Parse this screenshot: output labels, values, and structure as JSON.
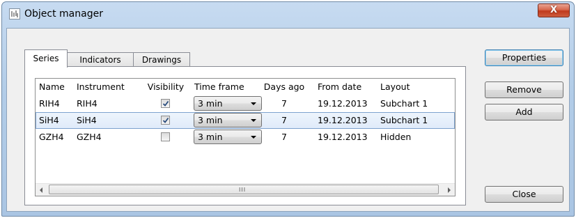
{
  "window": {
    "title": "Object manager",
    "close_glyph": "X",
    "app_icon": "chart-icon",
    "accent_color": "#c7dbf1",
    "close_color": "#c0391c"
  },
  "tabs": [
    {
      "label": "Series",
      "active": true
    },
    {
      "label": "Indicators",
      "active": false
    },
    {
      "label": "Drawings",
      "active": false
    }
  ],
  "table": {
    "columns": [
      "Name",
      "Instrument",
      "Visibility",
      "Time frame",
      "Days ago",
      "From date",
      "Layout"
    ],
    "rows": [
      {
        "name": "RIH4",
        "instrument": "RIH4",
        "visible": true,
        "time_frame": "3 min",
        "days_ago": "7",
        "from_date": "19.12.2013",
        "layout": "Subchart 1",
        "selected": false
      },
      {
        "name": "SiH4",
        "instrument": "SiH4",
        "visible": true,
        "time_frame": "3 min",
        "days_ago": "7",
        "from_date": "19.12.2013",
        "layout": "Subchart 1",
        "selected": true
      },
      {
        "name": "GZH4",
        "instrument": "GZH4",
        "visible": false,
        "time_frame": "3 min",
        "days_ago": "7",
        "from_date": "19.12.2013",
        "layout": "Hidden",
        "selected": false
      }
    ],
    "selected_row_color": "#dfeafa"
  },
  "buttons": {
    "properties": "Properties",
    "remove": "Remove",
    "add": "Add",
    "close": "Close"
  }
}
